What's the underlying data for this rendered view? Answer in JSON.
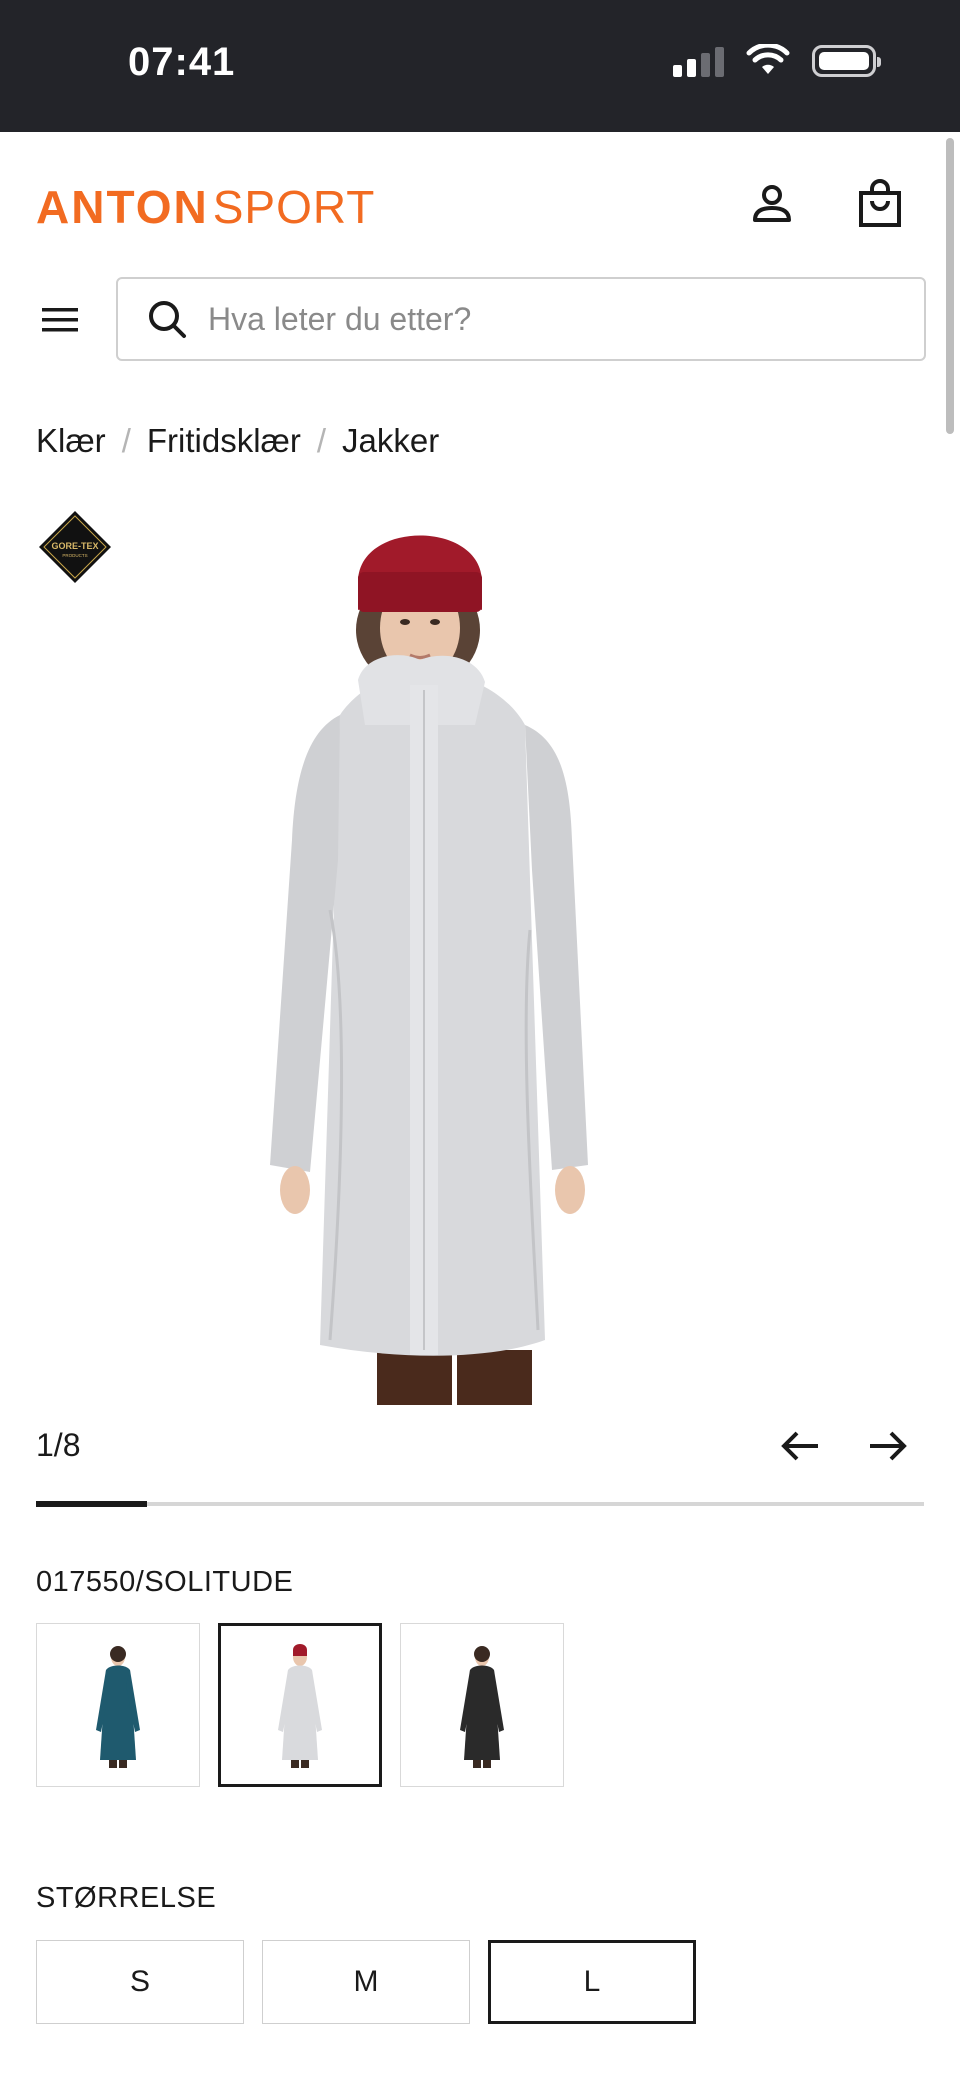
{
  "status_bar": {
    "time": "07:41"
  },
  "header": {
    "logo_part1": "ANTON",
    "logo_part2": "SPORT",
    "brand_color": "#f26b21"
  },
  "search": {
    "placeholder": "Hva leter du etter?"
  },
  "breadcrumb": [
    "Klær",
    "Fritidsklær",
    "Jakker"
  ],
  "gallery": {
    "badge_text": "GORE-TEX",
    "badge_subtext": "PRODUCTS",
    "counter": "1/8",
    "progress_fraction": 0.125
  },
  "variant": {
    "code": "017550/SOLITUDE",
    "swatches": [
      {
        "color": "#1f5a6e",
        "hat": false,
        "selected": false
      },
      {
        "color": "#d9dadd",
        "hat": true,
        "selected": true
      },
      {
        "color": "#2a2a2a",
        "hat": false,
        "selected": false
      }
    ]
  },
  "size": {
    "label": "STØRRELSE",
    "options": [
      {
        "label": "S",
        "selected": false
      },
      {
        "label": "M",
        "selected": false
      },
      {
        "label": "L",
        "selected": true
      }
    ]
  }
}
